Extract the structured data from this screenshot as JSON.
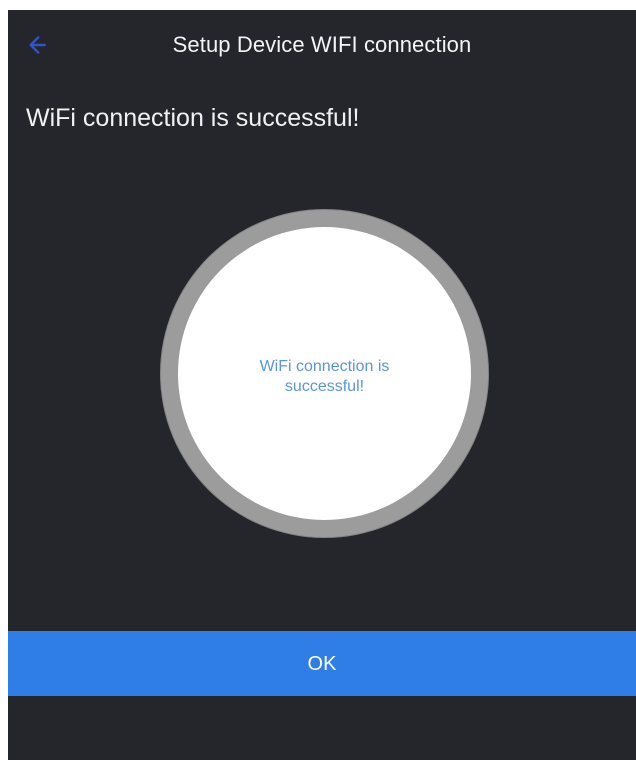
{
  "header": {
    "title": "Setup Device WIFI connection",
    "back_icon": "back-arrow-icon"
  },
  "status": {
    "message": "WiFi connection is successful!"
  },
  "circle": {
    "message": "WiFi connection is successful!"
  },
  "actions": {
    "ok_label": "OK"
  },
  "colors": {
    "background": "#24262c",
    "primary_button": "#2f7ee8",
    "circle_ring": "#9c9c9c",
    "circle_fill": "#ffffff",
    "circle_text": "#5a95de"
  }
}
